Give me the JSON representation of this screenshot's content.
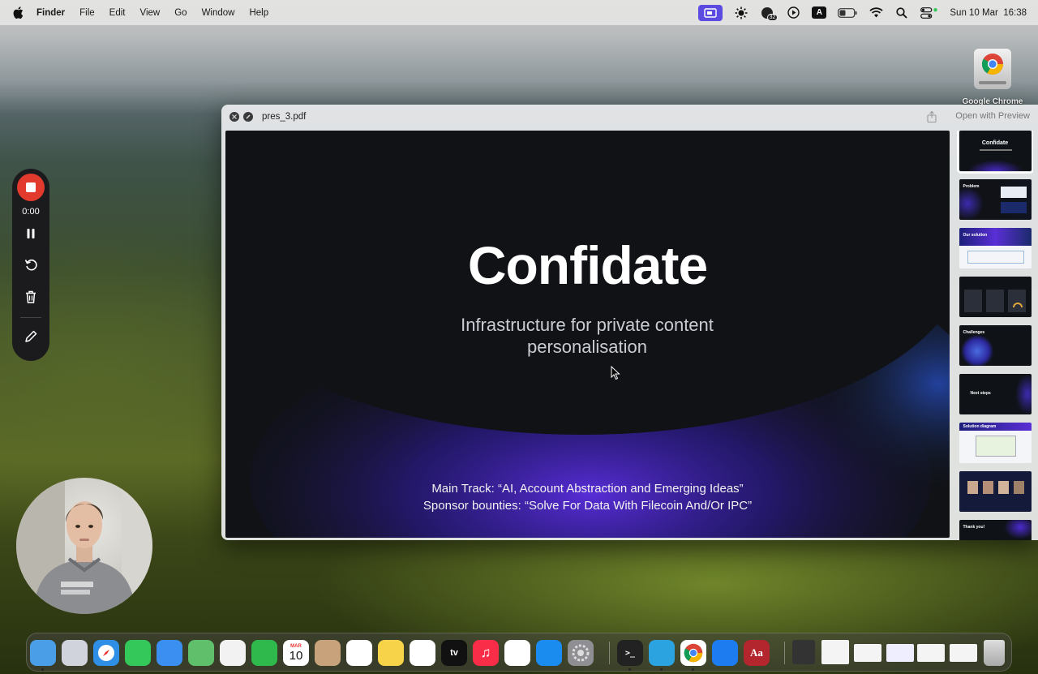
{
  "menubar": {
    "apple_icon": "apple-icon",
    "app_name": "Finder",
    "items": [
      "File",
      "Edit",
      "View",
      "Go",
      "Window",
      "Help"
    ],
    "status_icons": [
      "screen-share-icon",
      "brightness-icon",
      "notification-badge-icon",
      "play-icon",
      "keyboard-input-icon",
      "battery-icon",
      "wifi-icon",
      "search-icon",
      "control-center-icon"
    ],
    "notification_count": "32",
    "input_source": "A",
    "clock": "Sun 10 Mar  16:38"
  },
  "desktop": {
    "chrome_label": "Google Chrome"
  },
  "quicklook": {
    "file_name": "pres_3.pdf",
    "open_with": "Open with Preview",
    "slide": {
      "title": "Confidate",
      "subtitle": "Infrastructure for private content personalisation",
      "main_track": "Main Track: “AI, Account Abstraction and Emerging Ideas”",
      "sponsor": "Sponsor bounties: “Solve For Data With Filecoin And/Or IPC”"
    },
    "thumbnails": [
      {
        "label": "Confidate",
        "kind": "title"
      },
      {
        "label": "Problem",
        "kind": "dark"
      },
      {
        "label": "Our solution",
        "kind": "light"
      },
      {
        "label": "",
        "kind": "dark-cards"
      },
      {
        "label": "Challenges",
        "kind": "dark-orb"
      },
      {
        "label": "Next steps",
        "kind": "dark"
      },
      {
        "label": "Solution diagram",
        "kind": "light"
      },
      {
        "label": "",
        "kind": "team"
      },
      {
        "label": "Thank you!",
        "kind": "dark"
      }
    ]
  },
  "recorder": {
    "time": "0:00",
    "buttons": [
      "stop-record-icon",
      "pause-icon",
      "restart-icon",
      "trash-icon",
      "pen-icon"
    ]
  },
  "dock": {
    "calendar_month": "MAR",
    "calendar_day": "10",
    "tv_label": "tv",
    "dictionary_label": "Aa",
    "apps": [
      {
        "name": "finder",
        "color": "#4a9ee8",
        "running": true
      },
      {
        "name": "launchpad",
        "color": "#d0d3db",
        "running": false
      },
      {
        "name": "safari",
        "color": "#2f8fe6",
        "running": false
      },
      {
        "name": "messages",
        "color": "#34c759",
        "running": false
      },
      {
        "name": "mail",
        "color": "#3b8ff0",
        "running": false
      },
      {
        "name": "maps",
        "color": "#5fbf6a",
        "running": false
      },
      {
        "name": "photos",
        "color": "#f2f2f2",
        "running": false
      },
      {
        "name": "facetime",
        "color": "#2fb94c",
        "running": false
      },
      {
        "name": "calendar",
        "color": "#ffffff",
        "running": false
      },
      {
        "name": "contacts",
        "color": "#c8a27a",
        "running": false
      },
      {
        "name": "reminders",
        "color": "#ffffff",
        "running": false
      },
      {
        "name": "notes",
        "color": "#f7d34a",
        "running": false
      },
      {
        "name": "freeform",
        "color": "#ffffff",
        "running": false
      },
      {
        "name": "tv",
        "color": "#111111",
        "running": false
      },
      {
        "name": "music",
        "color": "#fa2d48",
        "running": false
      },
      {
        "name": "news",
        "color": "#ffffff",
        "running": false
      },
      {
        "name": "app-store",
        "color": "#1a8cf0",
        "running": false
      },
      {
        "name": "system-settings",
        "color": "#8e8e93",
        "running": false
      },
      {
        "name": "terminal",
        "color": "#222222",
        "running": true
      },
      {
        "name": "telegram",
        "color": "#2aa3e0",
        "running": true
      },
      {
        "name": "chrome",
        "color": "#ffffff",
        "running": true
      },
      {
        "name": "xcode",
        "color": "#1c7cf0",
        "running": false
      },
      {
        "name": "dictionary",
        "color": "#b3262e",
        "running": false
      }
    ]
  }
}
